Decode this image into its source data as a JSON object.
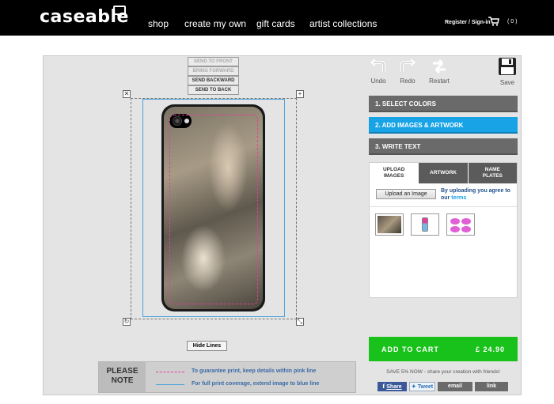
{
  "header": {
    "logo": "caseable",
    "nav": [
      "shop",
      "create my own",
      "gift cards",
      "artist collections"
    ],
    "register": "Register / Sign-in",
    "cart_count": "( 0 )"
  },
  "layer_menu": [
    "SEND TO FRONT",
    "BRING FORWARD",
    "SEND BACKWARD",
    "SEND TO BACK"
  ],
  "handles": {
    "close": "✕",
    "add": "+",
    "rotate": "↻",
    "resize": "⤡"
  },
  "hide_lines": "Hide Lines",
  "note": {
    "label_line1": "PLEASE",
    "label_line2": "NOTE",
    "pink_text": "To guarantee print, keep details within pink line",
    "blue_text": "For full print coverage, extend image to blue line",
    "pink_color": "#e0409a",
    "blue_color": "#4aa3df"
  },
  "tools": {
    "undo": "Undo",
    "redo": "Redo",
    "restart": "Restart",
    "save": "Save"
  },
  "steps": [
    "1. SELECT COLORS",
    "2. ADD IMAGES & ARTWORK",
    "3. WRITE TEXT"
  ],
  "tabs": {
    "upload_line1": "UPLOAD",
    "upload_line2": "IMAGES",
    "artwork": "ARTWORK",
    "name_line1": "NAME",
    "name_line2": "PLATES"
  },
  "upload": {
    "button": "Upload an Image",
    "agree_text": "By uploading you agree to our",
    "terms": "terms"
  },
  "cart": {
    "label": "ADD TO CART",
    "price": "£ 24.90",
    "color": "#19c21b"
  },
  "share": {
    "save_note": "SAVE 5% NOW - share your creation with friends!",
    "facebook": "Share",
    "twitter": "Tweet",
    "email": "email",
    "link": "link"
  },
  "accent": "#17a3e6"
}
